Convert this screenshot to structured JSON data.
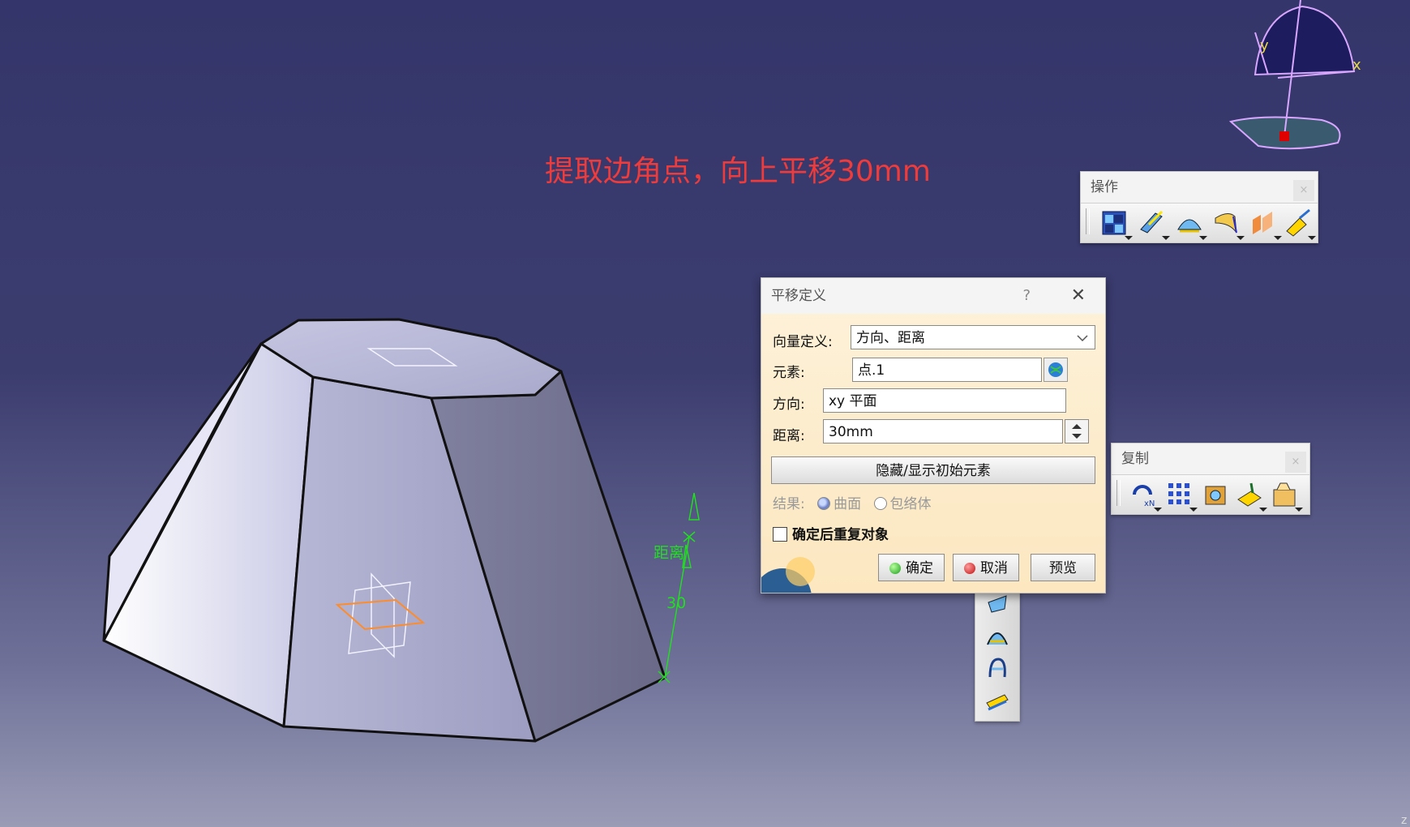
{
  "annotation": "提取边角点，向上平移30mm",
  "viewport": {
    "compass_x_label": "x",
    "compass_y_label": "y",
    "dimension_label": "距离",
    "dimension_value": "30",
    "corner_label": "z"
  },
  "toolbar_operations": {
    "title": "操作",
    "close": "×",
    "icons": [
      "join-icon",
      "heal-icon",
      "untrim-icon",
      "extract-icon",
      "fillet-icon",
      "transform-icon"
    ]
  },
  "toolbar_copy": {
    "title": "复制",
    "close": "×",
    "icons": [
      "repetition-icon",
      "pattern-icon",
      "powercopy-icon",
      "instantiate-icon",
      "catalog-icon"
    ]
  },
  "dialog": {
    "title": "平移定义",
    "help": "?",
    "close": "✕",
    "vector_definition_label": "向量定义:",
    "vector_definition_value": "方向、距离",
    "element_label": "元素:",
    "element_value": "点.1",
    "direction_label": "方向:",
    "direction_value": "xy 平面",
    "distance_label": "距离:",
    "distance_value": "30mm",
    "hide_show_button": "隐藏/显示初始元素",
    "result_label": "结果:",
    "result_surface": "曲面",
    "result_volume": "包络体",
    "repeat_label": "确定后重复对象",
    "ok_button": "确定",
    "cancel_button": "取消",
    "preview_button": "预览"
  },
  "colors": {
    "annotation": "#ee3b3b",
    "dimension_green": "#22dd22",
    "background_top": "#34356a",
    "dialog_bg": "#fce7c0"
  }
}
